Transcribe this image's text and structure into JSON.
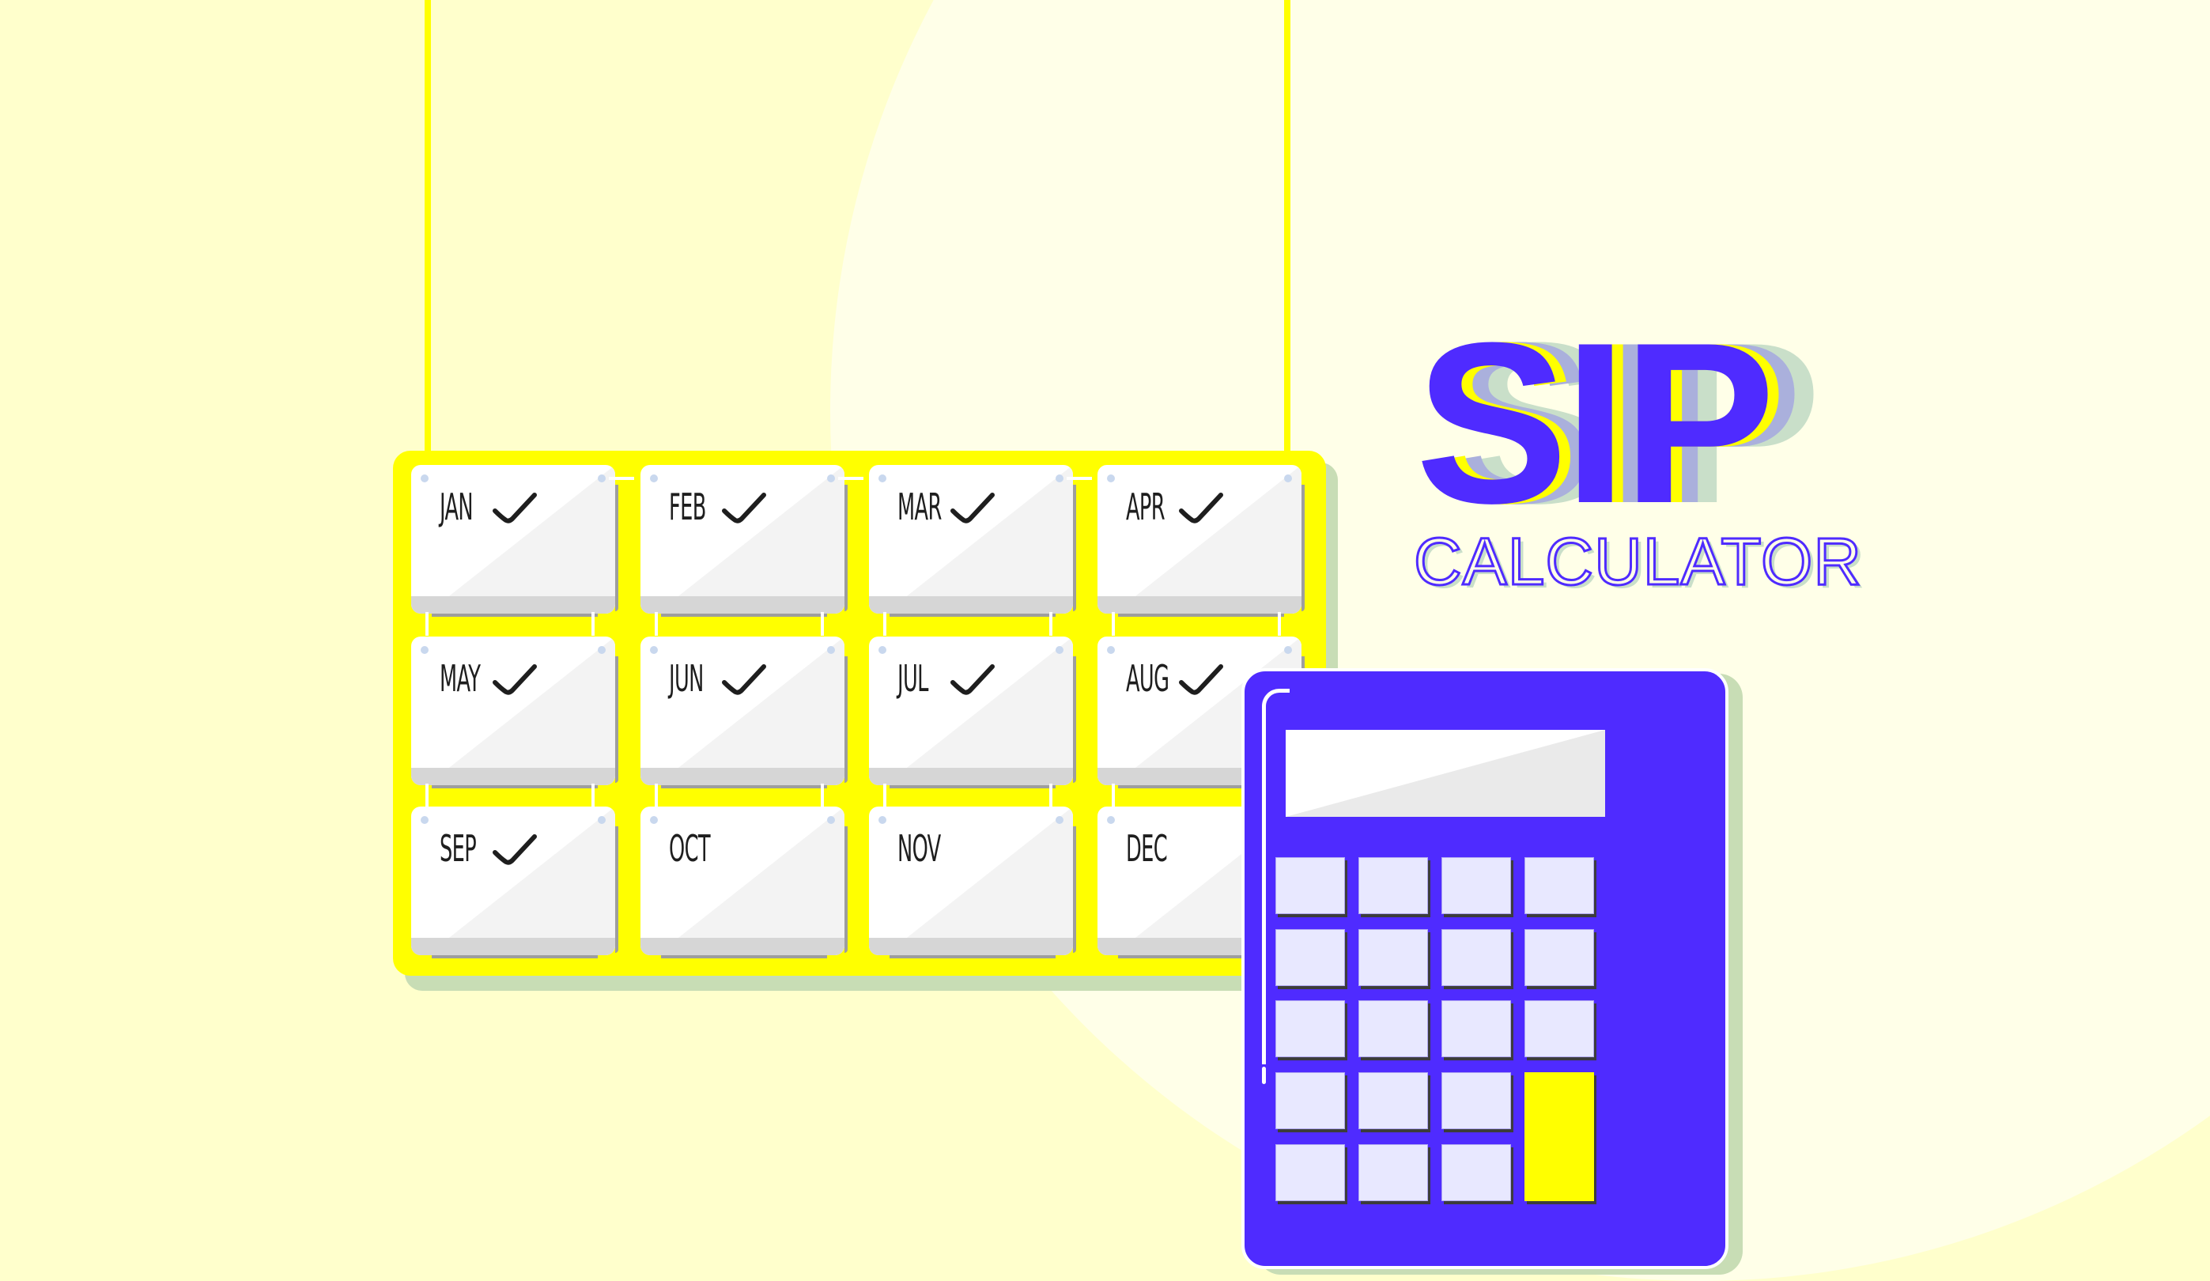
{
  "title": {
    "main": "SIP",
    "subtitle": "CALCULATOR"
  },
  "calendar": {
    "months": [
      {
        "label": "JAN",
        "checked": true
      },
      {
        "label": "FEB",
        "checked": true
      },
      {
        "label": "MAR",
        "checked": true
      },
      {
        "label": "APR",
        "checked": true
      },
      {
        "label": "MAY",
        "checked": true
      },
      {
        "label": "JUN",
        "checked": true
      },
      {
        "label": "JUL",
        "checked": true
      },
      {
        "label": "AUG",
        "checked": true
      },
      {
        "label": "SEP",
        "checked": true
      },
      {
        "label": "OCT",
        "checked": false
      },
      {
        "label": "NOV",
        "checked": false
      },
      {
        "label": "DEC",
        "checked": false
      }
    ],
    "check_icon": "checkmark-icon"
  },
  "calculator": {
    "display_value": "",
    "key_rows": 5,
    "key_cols": 4,
    "accent_key": "equals-key"
  },
  "colors": {
    "background": "#FFFFCC",
    "brand_primary": "#4F2BFF",
    "accent_yellow": "#FFFF00",
    "shadow_green": "#C8DDB5",
    "key_face": "#E8E8FF"
  }
}
